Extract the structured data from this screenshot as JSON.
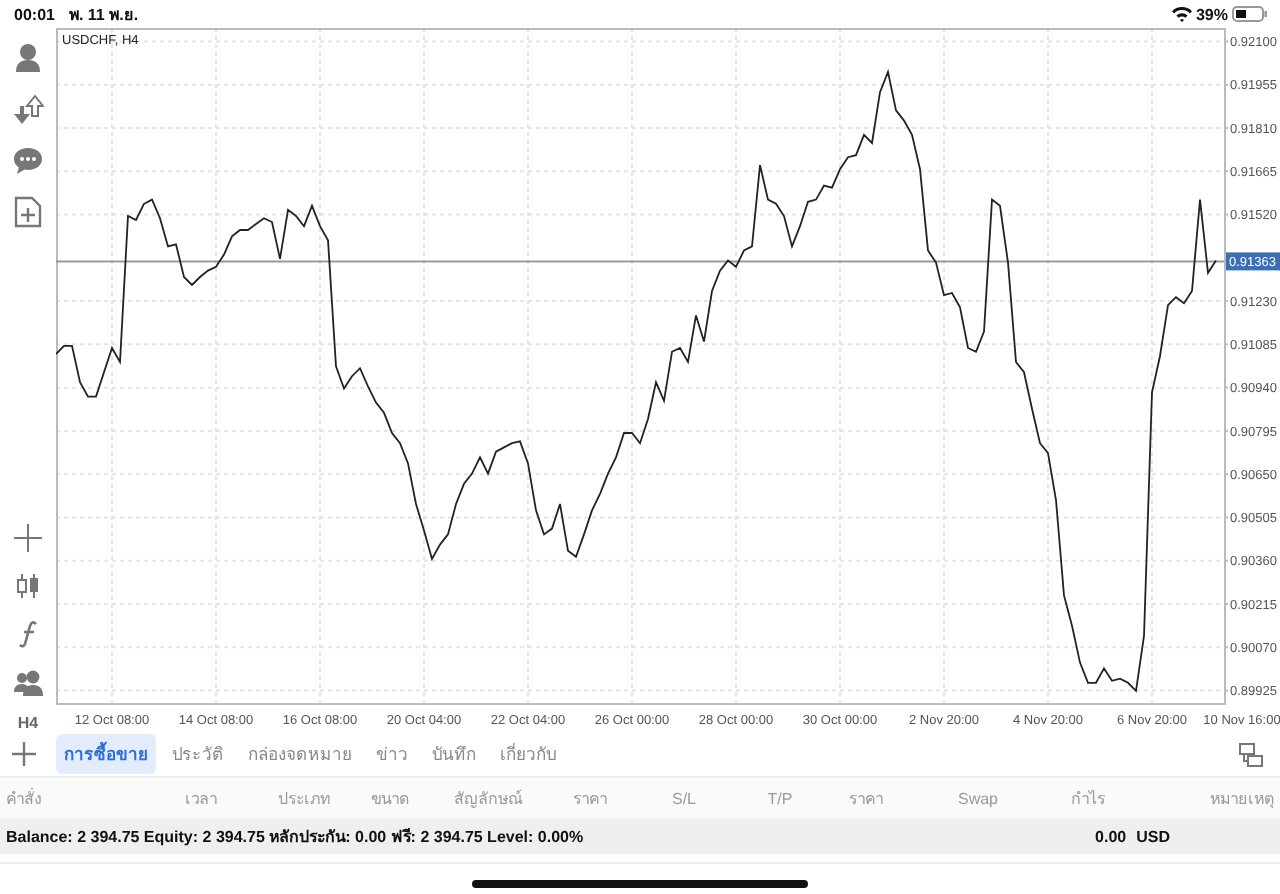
{
  "status_bar": {
    "time": "00:01",
    "date": "พ. 11 พ.ย.",
    "battery": "39%"
  },
  "toolbar": {
    "timeframe": "H4"
  },
  "chart": {
    "chart_data": {
      "type": "line",
      "title": "USDCHF, H4",
      "categories": [
        null,
        null,
        null,
        null,
        null,
        null,
        null,
        "12 Oct 08:00",
        null,
        null,
        null,
        null,
        null,
        null,
        null,
        null,
        null,
        null,
        null,
        null,
        "14 Oct 08:00",
        null,
        null,
        null,
        null,
        null,
        null,
        null,
        null,
        null,
        null,
        null,
        null,
        "16 Oct 08:00",
        null,
        null,
        null,
        null,
        null,
        null,
        null,
        null,
        null,
        null,
        null,
        null,
        "20 Oct 04:00",
        null,
        null,
        null,
        null,
        null,
        null,
        null,
        null,
        null,
        null,
        null,
        null,
        "22 Oct 04:00",
        null,
        null,
        null,
        null,
        null,
        null,
        null,
        null,
        null,
        null,
        null,
        null,
        "26 Oct 00:00",
        null,
        null,
        null,
        null,
        null,
        null,
        null,
        null,
        null,
        null,
        null,
        null,
        "28 Oct 00:00",
        null,
        null,
        null,
        null,
        null,
        null,
        null,
        null,
        null,
        null,
        null,
        null,
        "30 Oct 00:00",
        null,
        null,
        null,
        null,
        null,
        null,
        null,
        null,
        null,
        null,
        null,
        null,
        "2 Nov 20:00",
        null,
        null,
        null,
        null,
        null,
        null,
        null,
        null,
        null,
        null,
        null,
        null,
        "4 Nov 20:00",
        null,
        null,
        null,
        null,
        null,
        null,
        null,
        null,
        null,
        null,
        null,
        null,
        "6 Nov 20:00",
        null,
        null,
        null,
        null,
        null,
        null,
        null,
        null,
        null,
        null,
        null,
        "10 Nov 16:00"
      ],
      "values": [
        0.91053,
        0.9108,
        0.9108,
        0.90958,
        0.9091,
        0.9091,
        0.90992,
        0.91073,
        0.91026,
        0.91515,
        0.91502,
        0.91556,
        0.9157,
        0.91508,
        0.91413,
        0.9142,
        0.91311,
        0.91284,
        0.91311,
        0.91332,
        0.91345,
        0.91386,
        0.91447,
        0.91468,
        0.91468,
        0.91488,
        0.91508,
        0.91495,
        0.91372,
        0.91536,
        0.91515,
        0.91481,
        0.91549,
        0.91481,
        0.91434,
        0.91012,
        0.90937,
        0.90978,
        0.91005,
        0.90944,
        0.9089,
        0.90856,
        0.90788,
        0.90754,
        0.90686,
        0.9055,
        0.90461,
        0.90366,
        0.90414,
        0.90448,
        0.9055,
        0.90618,
        0.90652,
        0.90706,
        0.90652,
        0.90726,
        0.9074,
        0.90754,
        0.9076,
        0.90686,
        0.90529,
        0.90448,
        0.90468,
        0.9055,
        0.90393,
        0.90373,
        0.90448,
        0.90529,
        0.90584,
        0.90652,
        0.90706,
        0.90788,
        0.90788,
        0.90754,
        0.90835,
        0.90958,
        0.90896,
        0.9106,
        0.91073,
        0.91026,
        0.91182,
        0.91094,
        0.91264,
        0.91332,
        0.91366,
        0.91345,
        0.914,
        0.91413,
        0.91685,
        0.9157,
        0.91556,
        0.91515,
        0.91413,
        0.91481,
        0.91563,
        0.9157,
        0.91617,
        0.9161,
        0.91672,
        0.91712,
        0.91719,
        0.91787,
        0.9176,
        0.9193,
        0.91998,
        0.91869,
        0.91835,
        0.91787,
        0.91672,
        0.914,
        0.91359,
        0.9125,
        0.91257,
        0.91209,
        0.91073,
        0.9106,
        0.91128,
        0.9157,
        0.91549,
        0.91359,
        0.91026,
        0.90992,
        0.90869,
        0.90754,
        0.9072,
        0.90563,
        0.90244,
        0.90142,
        0.90019,
        0.89951,
        0.89951,
        0.89999,
        0.89958,
        0.89965,
        0.89951,
        0.89924,
        0.90108,
        0.90924,
        0.91046,
        0.91216,
        0.91243,
        0.91223,
        0.91264,
        0.9157,
        0.91325,
        0.91366,
        null,
        null,
        null,
        null
      ],
      "ylim": [
        0.8988,
        0.92145
      ],
      "yticks": [
        {
          "value": 0.921,
          "label": "0.92100"
        },
        {
          "value": 0.91955,
          "label": "0.91955"
        },
        {
          "value": 0.9181,
          "label": "0.91810"
        },
        {
          "value": 0.91665,
          "label": "0.91665"
        },
        {
          "value": 0.9152,
          "label": "0.91520"
        },
        {
          "value": 0.9123,
          "label": "0.91230"
        },
        {
          "value": 0.91085,
          "label": "0.91085"
        },
        {
          "value": 0.9094,
          "label": "0.90940"
        },
        {
          "value": 0.90795,
          "label": "0.90795"
        },
        {
          "value": 0.9065,
          "label": "0.90650"
        },
        {
          "value": 0.90505,
          "label": "0.90505"
        },
        {
          "value": 0.9036,
          "label": "0.90360"
        },
        {
          "value": 0.90215,
          "label": "0.90215"
        },
        {
          "value": 0.9007,
          "label": "0.90070"
        },
        {
          "value": 0.89925,
          "label": "0.89925"
        }
      ],
      "grid": true,
      "ref_lines": [
        {
          "axis": "y",
          "value": 0.91363,
          "label": "0.91363"
        }
      ]
    }
  },
  "tabs": [
    {
      "label": "การซื้อขาย",
      "selected": true
    },
    {
      "label": "ประวัติ",
      "selected": false
    },
    {
      "label": "กล่องจดหมาย",
      "selected": false
    },
    {
      "label": "ข่าว",
      "selected": false
    },
    {
      "label": "บันทึก",
      "selected": false
    },
    {
      "label": "เกี่ยวกับ",
      "selected": false
    }
  ],
  "table": {
    "columns": [
      "คำสั่ง",
      "เวลา",
      "ประเภท",
      "ขนาด",
      "สัญลักษณ์",
      "ราคา",
      "S/L",
      "T/P",
      "ราคา",
      "Swap",
      "กำไร",
      "หมายเหตุ"
    ]
  },
  "summary": {
    "text": "Balance: 2 394.75 Equity: 2 394.75 หลักประกัน: 0.00 ฟรี: 2 394.75 Level: 0.00%",
    "profit": "0.00",
    "currency": "USD"
  }
}
